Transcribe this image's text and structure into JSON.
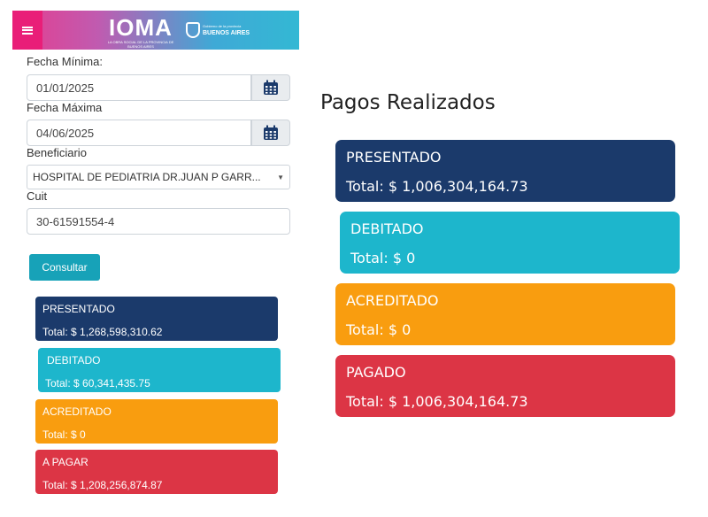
{
  "header": {
    "brand_name": "IOMA",
    "brand_tagline": "La obra social de la provincia de Buenos Aires",
    "gov_name": "BUENOS AIRES",
    "gov_small": "Gobierno de la provincia",
    "gradient_colors": [
      "#e63d8e",
      "#33b8d4"
    ]
  },
  "form": {
    "fecha_min_label": "Fecha Mínima:",
    "fecha_min_value": "01/01/2025",
    "fecha_max_label": "Fecha Máxima",
    "fecha_max_value": "04/06/2025",
    "beneficiario_label": "Beneficiario",
    "beneficiario_value": "HOSPITAL DE PEDIATRIA DR.JUAN P GARR...",
    "cuit_label": "Cuit",
    "cuit_value": "30-61591554-4",
    "consultar_label": "Consultar"
  },
  "left_cards": [
    {
      "title": "PRESENTADO",
      "total": "Total: $ 1,268,598,310.62",
      "color": "#1b3a6b"
    },
    {
      "title": "DEBITADO",
      "total": "Total: $ 60,341,435.75",
      "color": "#1db6cc"
    },
    {
      "title": "ACREDITADO",
      "total": "Total: $ 0",
      "color": "#f99d0f"
    },
    {
      "title": "A PAGAR",
      "total": "Total: $ 1,208,256,874.87",
      "color": "#dc3545"
    }
  ],
  "right": {
    "title": "Pagos Realizados",
    "cards": [
      {
        "title": "PRESENTADO",
        "total": "Total: $ 1,006,304,164.73",
        "color": "#1b3a6b"
      },
      {
        "title": "DEBITADO",
        "total": "Total: $ 0",
        "color": "#1db6cc"
      },
      {
        "title": "ACREDITADO",
        "total": "Total: $ 0",
        "color": "#f99d0f"
      },
      {
        "title": "PAGADO",
        "total": "Total: $ 1,006,304,164.73",
        "color": "#dc3545"
      }
    ]
  }
}
